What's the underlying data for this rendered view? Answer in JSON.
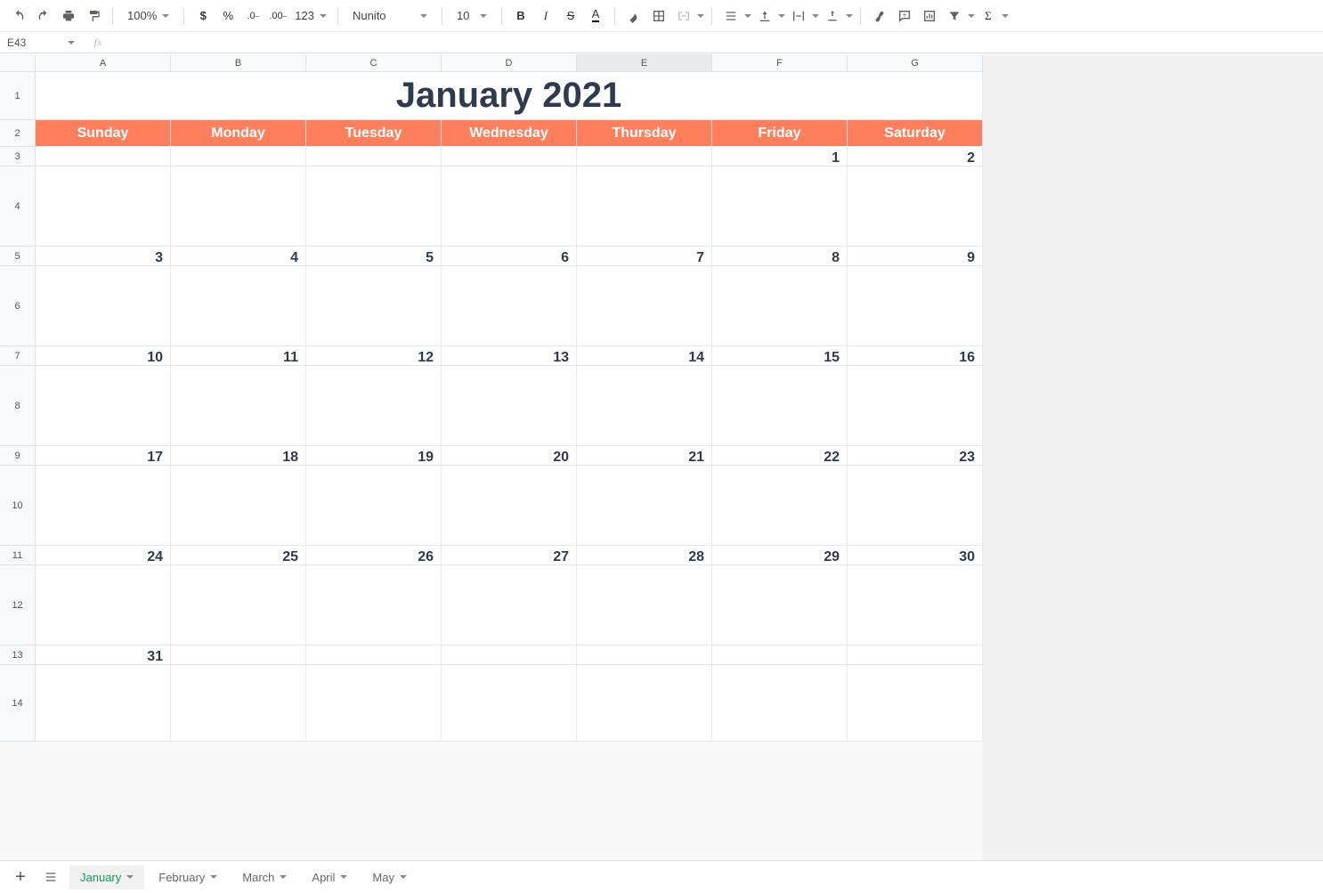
{
  "toolbar": {
    "zoom": "100%",
    "font_name": "Nunito",
    "font_size": "10",
    "format_more": "123"
  },
  "namebox": {
    "cell": "E43",
    "fx": "fx"
  },
  "columns": [
    "A",
    "B",
    "C",
    "D",
    "E",
    "F",
    "G"
  ],
  "row_headers": [
    "1",
    "2",
    "3",
    "4",
    "5",
    "6",
    "7",
    "8",
    "9",
    "10",
    "11",
    "12",
    "13",
    "14"
  ],
  "calendar": {
    "title": "January 2021",
    "days": [
      "Sunday",
      "Monday",
      "Tuesday",
      "Wednesday",
      "Thursday",
      "Friday",
      "Saturday"
    ],
    "weeks": [
      [
        "",
        "",
        "",
        "",
        "",
        "1",
        "2"
      ],
      [
        "3",
        "4",
        "5",
        "6",
        "7",
        "8",
        "9"
      ],
      [
        "10",
        "11",
        "12",
        "13",
        "14",
        "15",
        "16"
      ],
      [
        "17",
        "18",
        "19",
        "20",
        "21",
        "22",
        "23"
      ],
      [
        "24",
        "25",
        "26",
        "27",
        "28",
        "29",
        "30"
      ],
      [
        "31",
        "",
        "",
        "",
        "",
        "",
        ""
      ]
    ]
  },
  "selected_column_index": 4,
  "sheet_tabs": [
    {
      "label": "January",
      "active": true
    },
    {
      "label": "February",
      "active": false
    },
    {
      "label": "March",
      "active": false
    },
    {
      "label": "April",
      "active": false
    },
    {
      "label": "May",
      "active": false
    }
  ]
}
